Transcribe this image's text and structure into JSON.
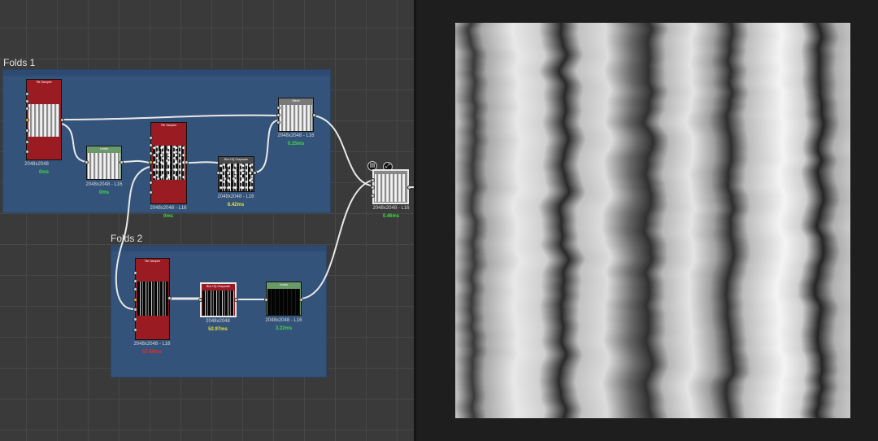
{
  "frames": {
    "folds1": {
      "title": "Folds 1"
    },
    "folds2": {
      "title": "Folds 2"
    }
  },
  "nodes": {
    "tile_sampler_1": {
      "title": "Tile Sampler",
      "size": "2048x2048",
      "time": "0ms",
      "time_color": "#3ddc3d"
    },
    "levels_1": {
      "title": "Levels",
      "size": "2048x2048 - L16",
      "time": "0ms",
      "time_color": "#3ddc3d"
    },
    "tile_sampler_2": {
      "title": "Tile Sampler",
      "size": "2048x2048 - L16",
      "time": "0ms",
      "time_color": "#3ddc3d"
    },
    "blur_hq_1": {
      "title": "Blur HQ Grayscale",
      "size": "2048x2048 - L16",
      "time": "6.42ms",
      "time_color": "#e8e23a"
    },
    "blend_1": {
      "title": "Blend",
      "size": "2048x2048 - L16",
      "time": "0.25ms",
      "time_color": "#3ddc3d"
    },
    "output_node": {
      "size": "2048x2048 - L16",
      "time": "0.46ms",
      "time_color": "#3ddc3d"
    },
    "tile_sampler_3": {
      "title": "Tile Sampler",
      "size": "2048x2048 - L16",
      "time": "57.60ms",
      "time_color": "#e03030"
    },
    "blur_hq_2": {
      "title": "Blur HQ Grayscale",
      "size": "2048x2048",
      "time": "52.97ms",
      "time_color": "#e8e23a"
    },
    "levels_2": {
      "title": "Levels",
      "size": "2048x2048 - L16",
      "time": "3.22ms",
      "time_color": "#3ddc3d"
    }
  },
  "colors": {
    "frame_bg": "#34547c",
    "tile_sampler_header": "#9a1c22",
    "levels_header": "#6a9a6a",
    "blur_header": "#4a4a4a",
    "canvas_bg": "#3a3a3a",
    "grid_line": "#474747"
  },
  "icons": {
    "output_icon_1": "copy-icon",
    "output_icon_2": "expand-icon"
  }
}
